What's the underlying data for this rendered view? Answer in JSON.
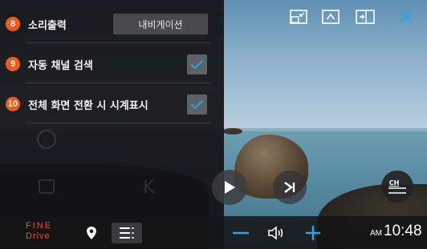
{
  "settings": {
    "items": [
      {
        "number": "8",
        "label": "소리출력",
        "button": "내비게이션"
      },
      {
        "number": "9",
        "label": "자동 채널 검색",
        "checked": true
      },
      {
        "number": "10",
        "label": "전체 화면 전환 시 시계표시",
        "checked": true
      }
    ]
  },
  "top_controls": [
    "pip-icon",
    "collapse-up-icon",
    "split-view-icon",
    "close-icon"
  ],
  "controls": {
    "ch_label": "CH"
  },
  "bottom_bar": {
    "logo_line1": "FINE",
    "logo_line2": "Drive",
    "ampm": "AM",
    "time": "10:48"
  },
  "colors": {
    "accent": "#2aa7e6",
    "badge": "#f05a1a",
    "logo": "#e8562a"
  }
}
